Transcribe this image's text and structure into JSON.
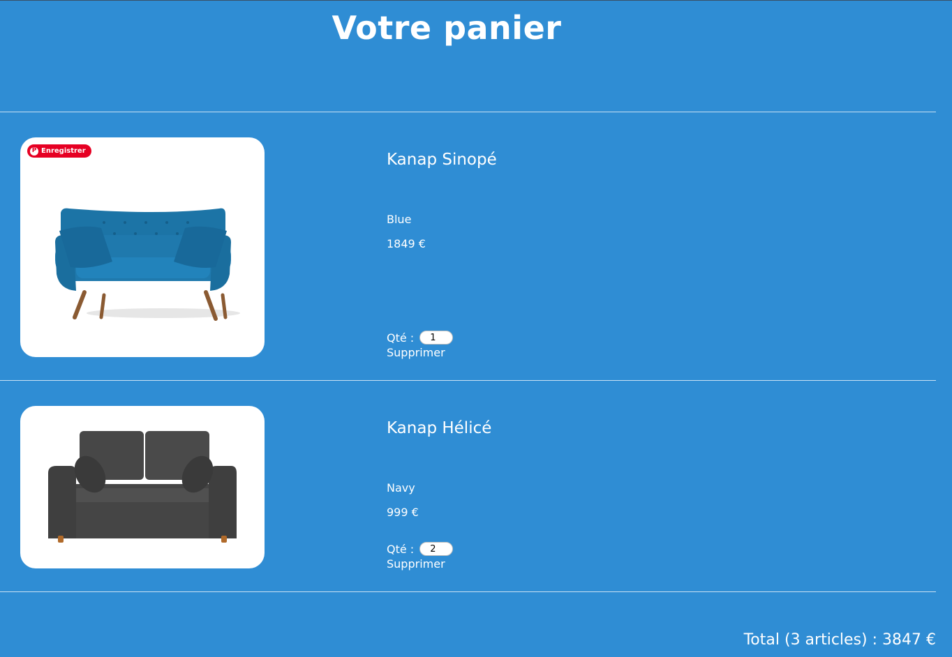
{
  "page": {
    "title": "Votre panier"
  },
  "cart": {
    "items": [
      {
        "name": "Kanap Sinopé",
        "color": "Blue",
        "price": "1849 €",
        "qty_label": "Qté :",
        "qty_value": "1",
        "delete_label": "Supprimer",
        "image_icon": "blue-sofa-image",
        "pin_badge": "Enregistrer"
      },
      {
        "name": "Kanap Hélicé",
        "color": "Navy",
        "price": "999 €",
        "qty_label": "Qté :",
        "qty_value": "2",
        "delete_label": "Supprimer",
        "image_icon": "grey-sofa-image"
      }
    ],
    "total_text": "Total (3 articles) : 3847 €"
  },
  "colors": {
    "background": "#2f8dd4",
    "text": "#ffffff",
    "pin_red": "#e60023",
    "sofa_blue": "#1f79ad",
    "sofa_grey": "#4a4a4a"
  }
}
